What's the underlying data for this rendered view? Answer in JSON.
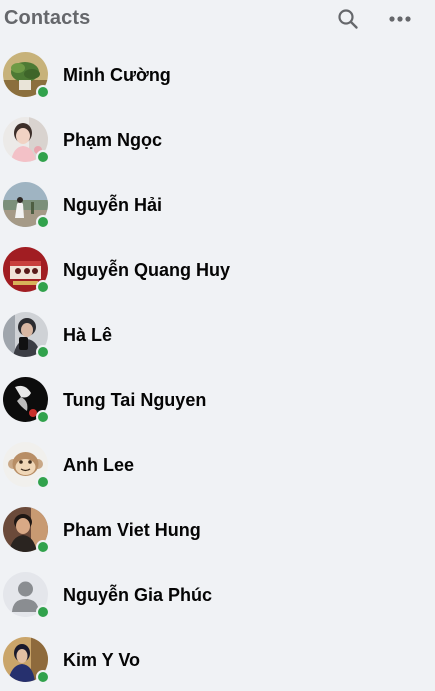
{
  "header": {
    "title": "Contacts",
    "search_icon": "search-icon",
    "more_icon": "more-horizontal-icon"
  },
  "colors": {
    "online": "#31a24c",
    "background": "#f0f2f5",
    "header_text": "#65676b",
    "name_text": "#050505"
  },
  "contacts": [
    {
      "name": "Minh Cường",
      "online": true,
      "avatar": "photo-plant"
    },
    {
      "name": "Phạm Ngọc",
      "online": true,
      "avatar": "photo-child"
    },
    {
      "name": "Nguyễn Hải",
      "online": true,
      "avatar": "photo-landscape"
    },
    {
      "name": "Nguyễn Quang Huy",
      "online": true,
      "avatar": "photo-red"
    },
    {
      "name": "Hà Lê",
      "online": true,
      "avatar": "photo-mirror-selfie"
    },
    {
      "name": "Tung Tai Nguyen",
      "online": true,
      "avatar": "photo-dark"
    },
    {
      "name": "Anh Lee",
      "online": true,
      "avatar": "monkey-illustration"
    },
    {
      "name": "Pham Viet Hung",
      "online": true,
      "avatar": "photo-man"
    },
    {
      "name": "Nguyễn Gia Phúc",
      "online": true,
      "avatar": "default-silhouette"
    },
    {
      "name": "Kim Y Vo",
      "online": true,
      "avatar": "photo-woman"
    }
  ]
}
